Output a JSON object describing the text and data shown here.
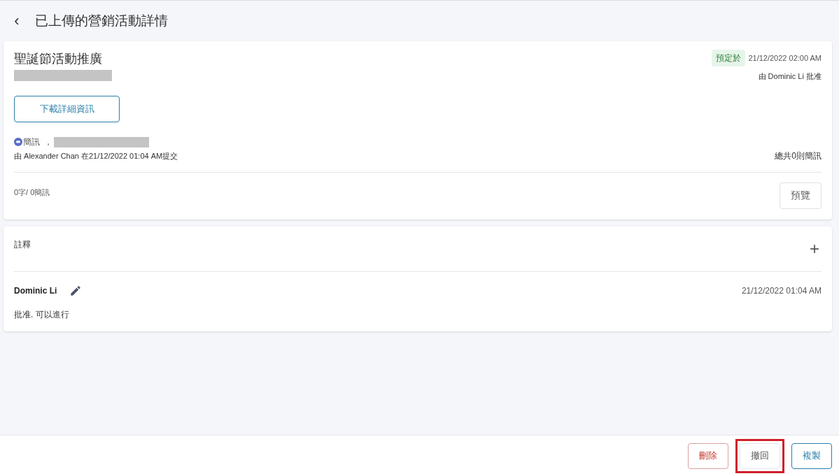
{
  "header": {
    "back": "‹",
    "title": "已上傳的營銷活動詳情"
  },
  "campaign": {
    "name": "聖誕節活動推廣",
    "status_label": "預定於",
    "scheduled_time": "21/12/2022 02:00 AM",
    "approved_by": "由 Dominic Li 批准",
    "download_button": "下載詳細資訊",
    "channel": "簡訊",
    "separator": "，",
    "submitted_by": "由 Alexander Chan 在21/12/2022 01:04 AM提交",
    "total": "總共0則簡訊",
    "count": "0字/ 0簡訊",
    "preview_button": "預覽"
  },
  "notes": {
    "title": "註釋",
    "add": "+",
    "items": [
      {
        "author": "Dominic Li",
        "time": "21/12/2022 01:04 AM",
        "text": "批准. 可以進行"
      }
    ]
  },
  "footer_buttons": [
    {
      "kind": "danger",
      "label": "刪除",
      "highlighted": false
    },
    {
      "kind": "plain",
      "label": "撤回",
      "highlighted": true
    },
    {
      "kind": "primary",
      "label": "複製",
      "highlighted": false
    }
  ]
}
